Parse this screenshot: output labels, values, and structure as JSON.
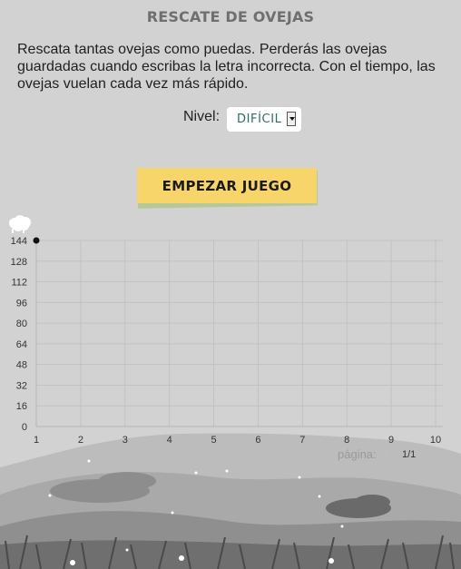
{
  "game": {
    "title": "RESCATE DE OVEJAS",
    "description": "Rescata tantas ovejas como puedas. Perderás las ovejas guardadas cuando escribas la letra incorrecta. Con el tiempo, las ovejas vuelan cada vez más rápido.",
    "level_label": "Nivel:",
    "level_value": "DIFÍCIL",
    "start_button": "EMPEZAR JUEGO"
  },
  "pagination": {
    "label": "página:",
    "prev": "‹",
    "current": "1/1",
    "next": "›"
  },
  "icons": {
    "sheep": "sheep-icon",
    "select_arrow": "chevron-down-icon"
  },
  "colors": {
    "background": "#d2d2d2",
    "button": "#f7d56a",
    "level_text": "#2e6b66",
    "title": "#6f6f6f"
  },
  "chart_data": {
    "type": "scatter",
    "x_ticks": [
      "1",
      "2",
      "3",
      "4",
      "5",
      "6",
      "7",
      "8",
      "9",
      "10"
    ],
    "y_ticks": [
      "0",
      "16",
      "32",
      "48",
      "64",
      "80",
      "96",
      "112",
      "128",
      "144"
    ],
    "xlim": [
      1,
      10
    ],
    "ylim": [
      0,
      144
    ],
    "grid": true,
    "points": [
      {
        "x": 1,
        "y": 144
      }
    ]
  }
}
